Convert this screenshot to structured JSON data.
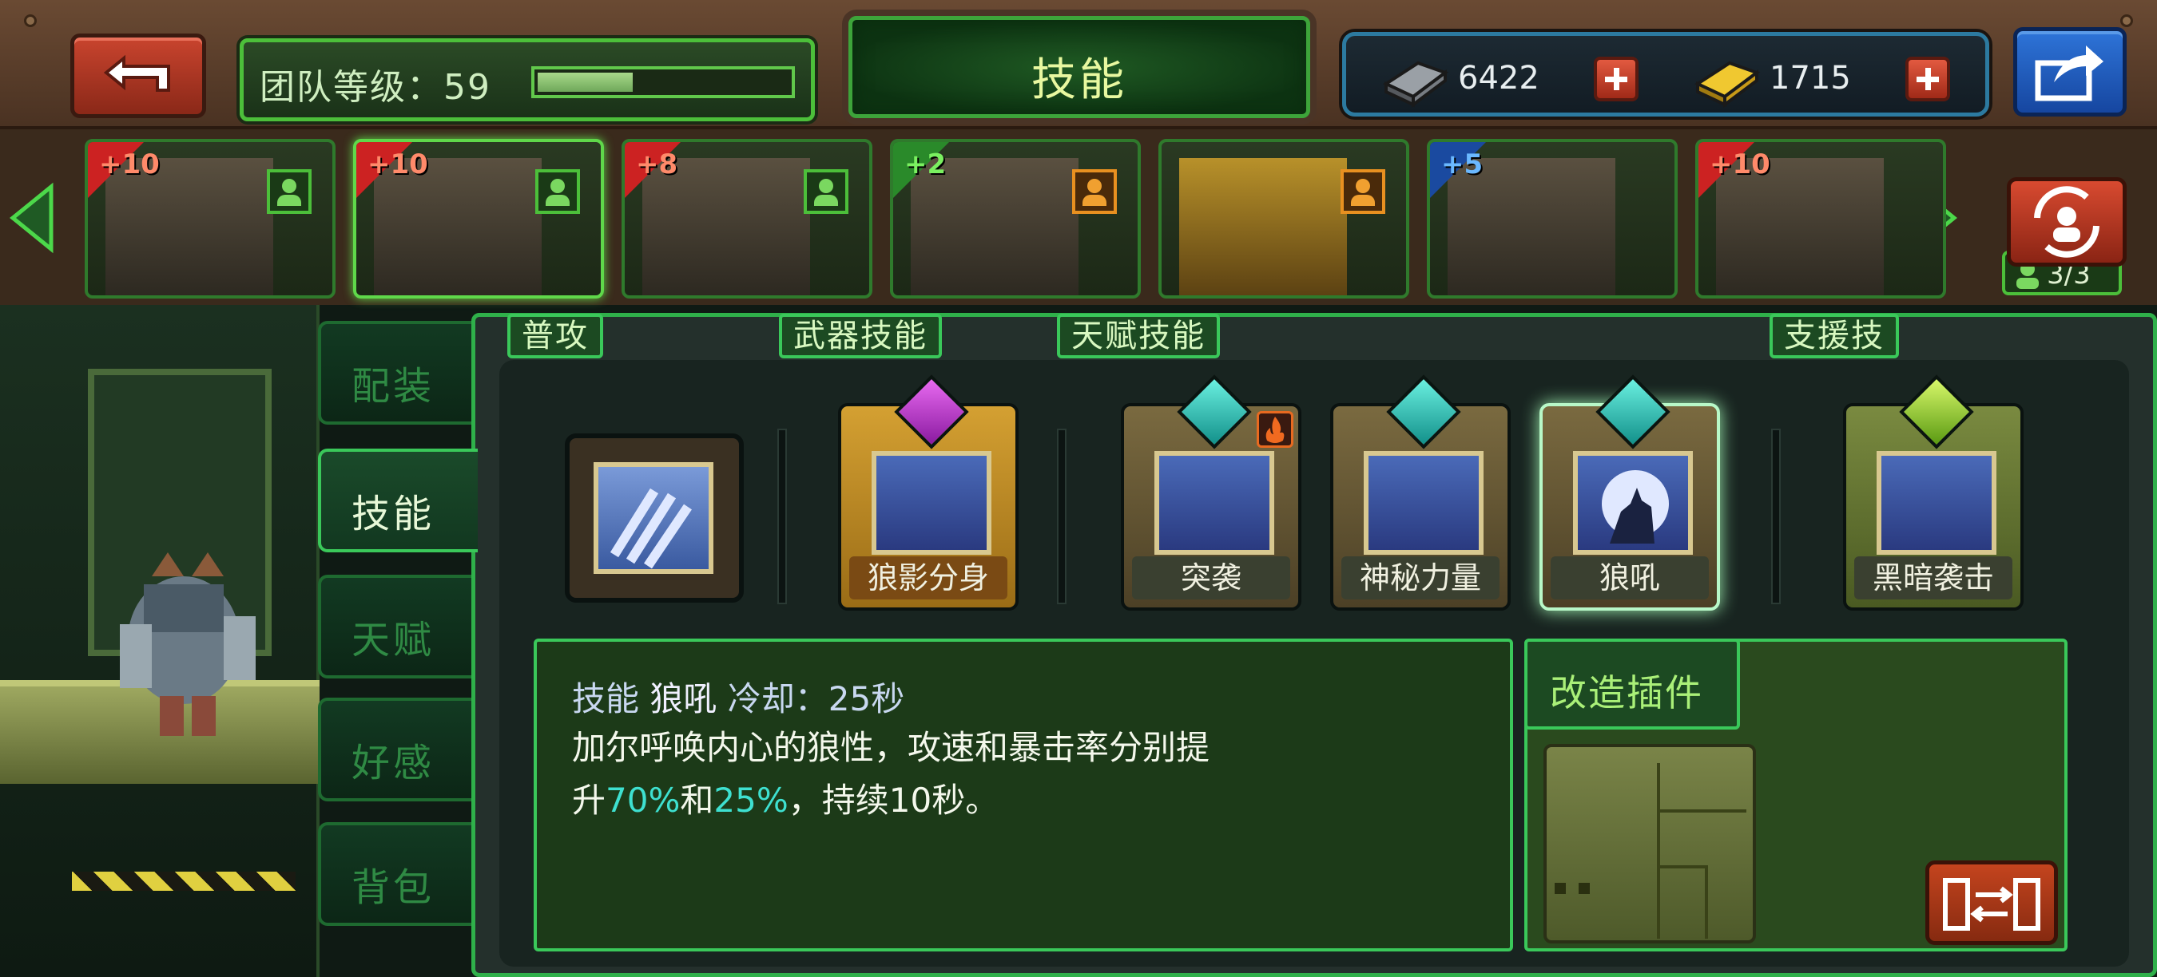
{
  "header": {
    "team_level_label": "团队等级：59",
    "team_level_progress": 0.38,
    "title": "技能",
    "currency": [
      {
        "icon": "silver-ingot-icon",
        "value": "6422"
      },
      {
        "icon": "gold-ingot-icon",
        "value": "1715"
      }
    ]
  },
  "heroes": [
    {
      "bonus": "+10",
      "flag": "red",
      "role": "green"
    },
    {
      "bonus": "+10",
      "flag": "red",
      "role": "green",
      "selected": true
    },
    {
      "bonus": "+8",
      "flag": "red",
      "role": "green"
    },
    {
      "bonus": "+2",
      "flag": "green",
      "role": "orange"
    },
    {
      "bonus": "",
      "flag": "none",
      "role": "orange"
    },
    {
      "bonus": "+5",
      "flag": "blue",
      "role": "none"
    },
    {
      "bonus": "+10",
      "flag": "red",
      "role": "none"
    }
  ],
  "team_count": "3/3",
  "side_tabs": [
    "配装",
    "技能",
    "天赋",
    "好感",
    "背包"
  ],
  "sections": {
    "basic": "普攻",
    "weapon": "武器技能",
    "talent": "天赋技能",
    "support": "支援技"
  },
  "skills": [
    {
      "name": "狼影分身",
      "gem": "purple"
    },
    {
      "name": "突袭",
      "gem": "teal"
    },
    {
      "name": "神秘力量",
      "gem": "teal"
    },
    {
      "name": "狼吼",
      "gem": "teal"
    },
    {
      "name": "黑暗袭击",
      "gem": "lime"
    }
  ],
  "description": {
    "prefix": "技能",
    "skill_name": "狼吼",
    "cooldown": "冷却：25秒",
    "line1": "加尔呼唤内心的狼性，攻速和暴击率分别提",
    "line2_a": "升",
    "line2_b": "70%",
    "line2_c": "和",
    "line2_d": "25%",
    "line2_e": "，持续10秒。"
  },
  "plugin": {
    "title": "改造插件"
  },
  "colors": {
    "accent_green": "#3ac85a",
    "highlight_teal": "#3ee0d0",
    "title_yellow": "#e8f8a0"
  }
}
